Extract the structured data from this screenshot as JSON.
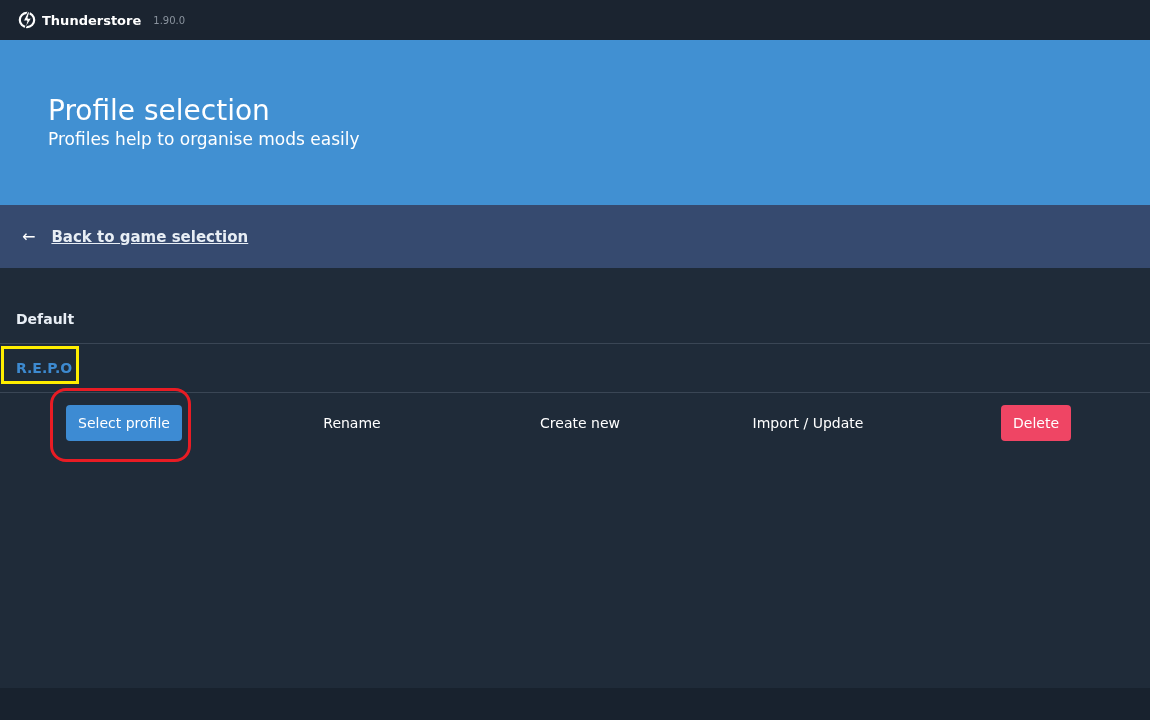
{
  "window": {
    "title": "Thunderstore",
    "version": "1.90.0"
  },
  "hero": {
    "title": "Profile selection",
    "subtitle": "Profiles help to organise mods easily"
  },
  "back_link": {
    "icon": "←",
    "label": "Back to game selection"
  },
  "profiles": [
    {
      "name": "Default",
      "selected": false
    },
    {
      "name": "R.E.P.O",
      "selected": true
    }
  ],
  "actions": [
    {
      "label": "Select profile",
      "kind": "primary"
    },
    {
      "label": "Rename",
      "kind": "plain"
    },
    {
      "label": "Create new",
      "kind": "plain"
    },
    {
      "label": "Import / Update",
      "kind": "plain"
    },
    {
      "label": "Delete",
      "kind": "danger"
    }
  ]
}
